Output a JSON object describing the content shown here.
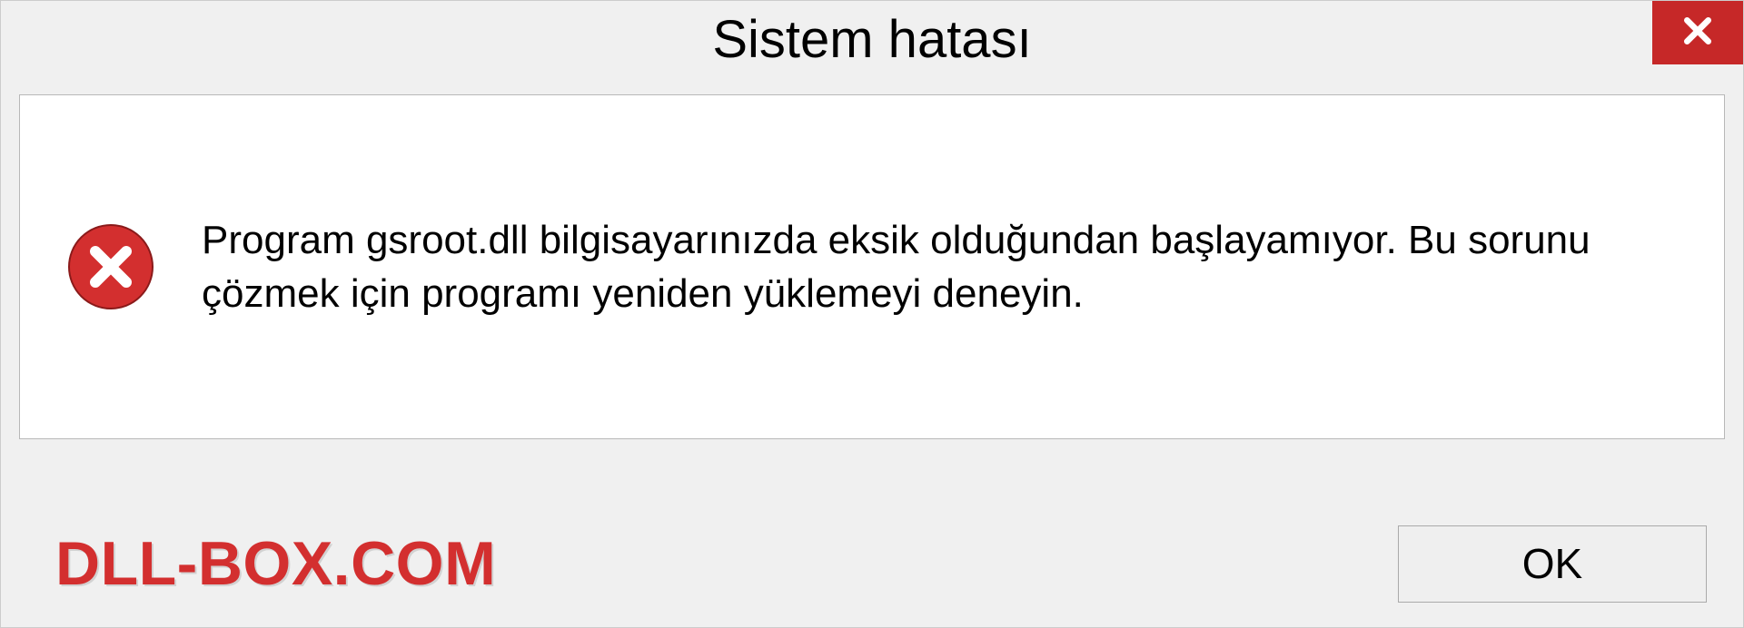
{
  "title": "Sistem hatası",
  "close_icon": "close",
  "error_icon": "error-circle",
  "message": "Program gsroot.dll bilgisayarınızda eksik olduğundan başlayamıyor. Bu sorunu çözmek için programı yeniden yüklemeyi deneyin.",
  "watermark": "DLL-BOX.COM",
  "ok_label": "OK"
}
